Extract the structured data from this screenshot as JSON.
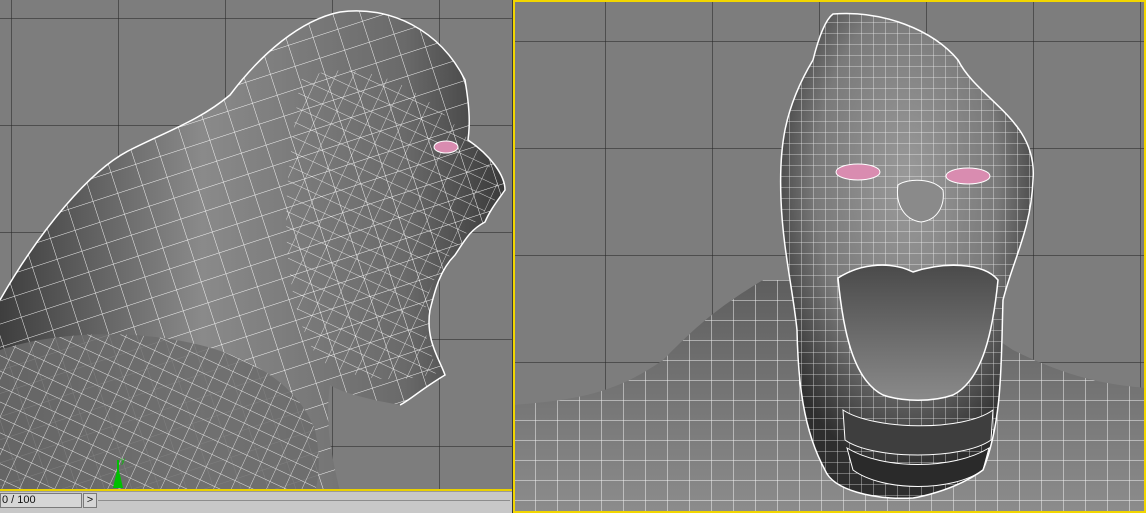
{
  "viewports": {
    "left": {
      "view": "side"
    },
    "right": {
      "view": "front",
      "active": true
    }
  },
  "time_slider": {
    "frame_label": "0 / 100",
    "next_glyph": ">"
  },
  "colors": {
    "active_border": "#f2d600",
    "mesh_wire": "#ffffff",
    "mesh_shade": "#5a5a5a",
    "eye": "#d98cb0",
    "viewport_bg": "#7d7d7d",
    "axis_y": "#00c000"
  },
  "icons": {
    "axis": "axis-tripod-icon",
    "next_frame": "chevron-right-icon"
  }
}
